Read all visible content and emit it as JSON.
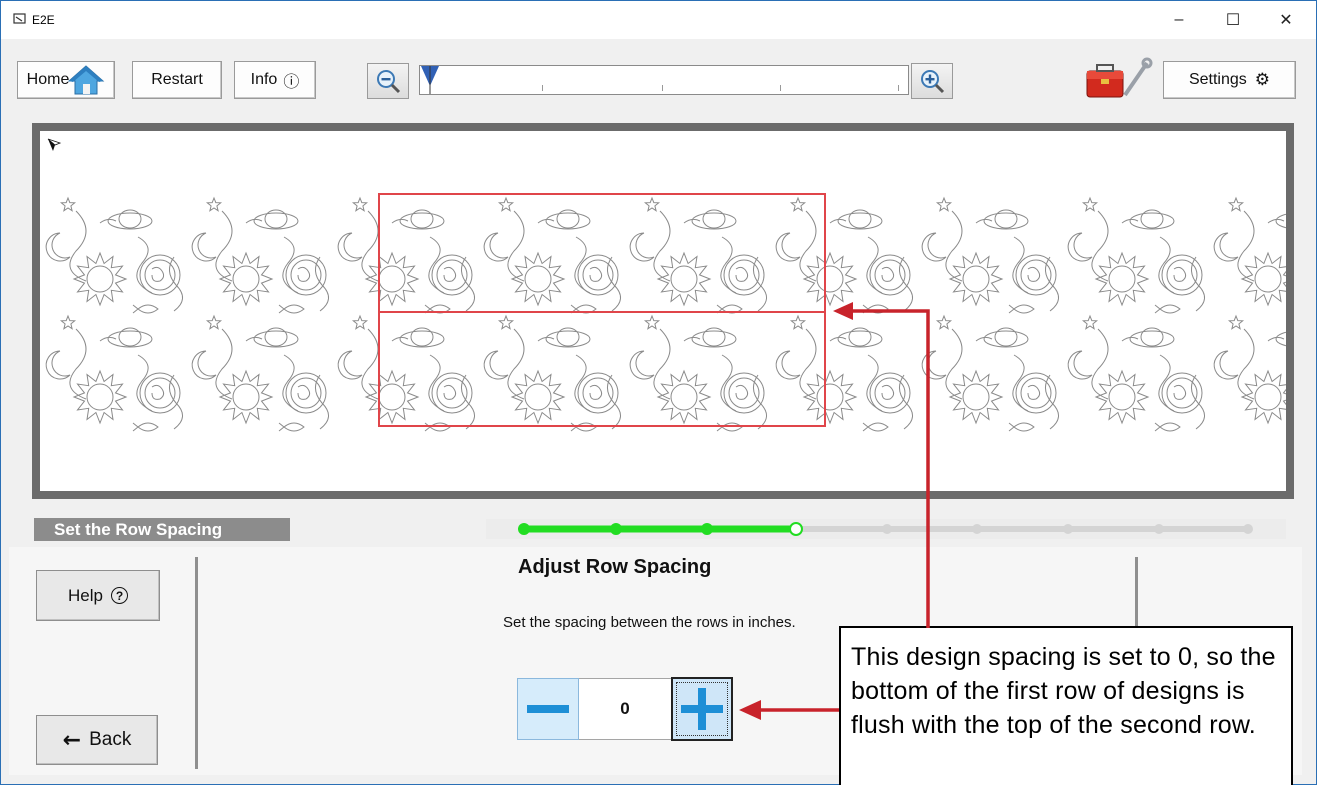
{
  "window": {
    "title": "E2E",
    "minimize": "–",
    "maximize": "☐",
    "close": "✕"
  },
  "toolbar": {
    "home_label": "Home",
    "restart_label": "Restart",
    "info_label": "Info",
    "info_glyph": "ⓘ",
    "settings_label": "Settings",
    "settings_glyph": "⚙"
  },
  "step": {
    "title": "Set the Row Spacing",
    "progress": {
      "total": 9,
      "completed": 3,
      "current": 4
    }
  },
  "sidebar": {
    "help_label": "Help",
    "help_glyph": "?",
    "back_label": "Back",
    "back_glyph": "←"
  },
  "main": {
    "heading": "Adjust Row Spacing",
    "description": "Set the spacing between the rows in inches.",
    "spacing_value": "0"
  },
  "callout": {
    "text": "This design spacing is set to 0, so the bottom of the first row of designs is flush with the top of the second row."
  },
  "colors": {
    "accent_green": "#22dd22",
    "callout_red": "#c8232b",
    "stepper_blue": "#1e8fd6",
    "header_gray": "#8c8c8c"
  },
  "icons": {
    "home": "house-icon",
    "zoom_out": "zoom-out-icon",
    "zoom_in": "zoom-in-icon",
    "toolbox": "toolbox-icon",
    "settings": "gear-icon"
  }
}
